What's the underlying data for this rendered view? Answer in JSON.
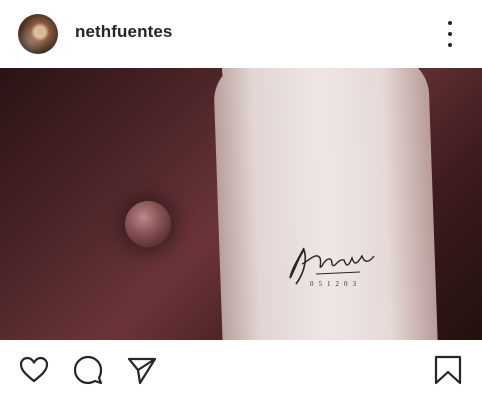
{
  "post": {
    "username": "nethfuentes",
    "tattoo_text": "Mairi",
    "tattoo_date": "051203"
  },
  "icons": {
    "more": "more-dots-icon",
    "like": "heart-icon",
    "comment": "comment-icon",
    "share": "send-icon",
    "save": "bookmark-icon"
  },
  "colors": {
    "text": "#262626",
    "background": "#ffffff"
  }
}
